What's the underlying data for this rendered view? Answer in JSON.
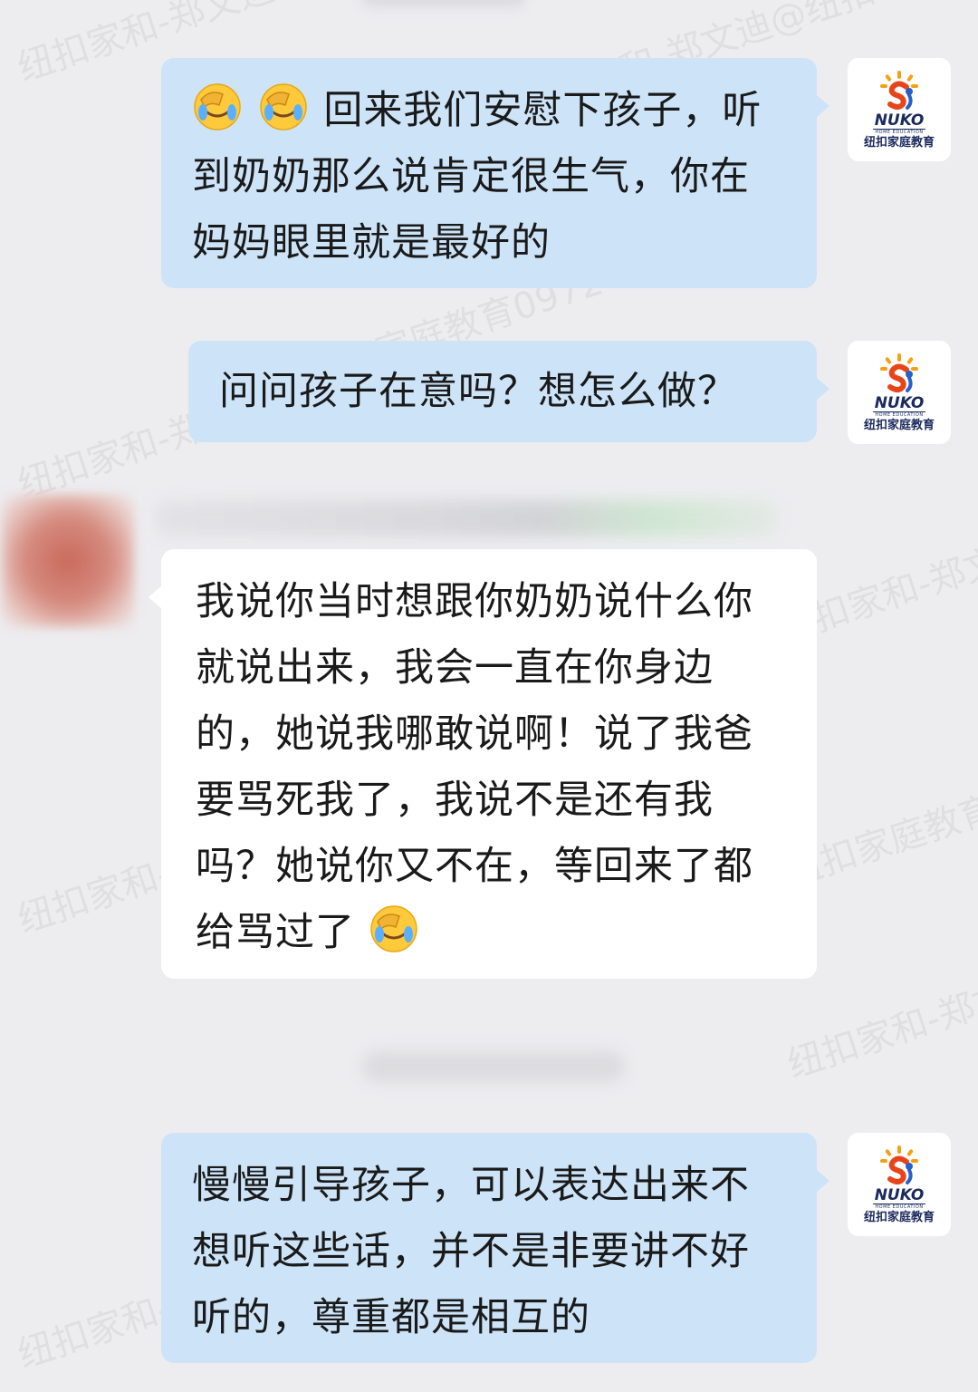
{
  "watermark": {
    "line1": "纽扣家和-郑文迪@纽扣",
    "line2": "纽扣家庭教育0972"
  },
  "logo": {
    "brand": "NUKO",
    "subtitle": "HOME EDUCATION",
    "cn": "纽扣家庭教育"
  },
  "messages": [
    {
      "side": "out",
      "text": "回来我们安慰下孩子，听到奶奶那么说肯定很生气，你在妈妈眼里就是最好的",
      "emoji_prefix": "facepalm-crying-emoji x2"
    },
    {
      "side": "out",
      "text": "问问孩子在意吗？想怎么做？"
    },
    {
      "side": "in",
      "text": "我说你当时想跟你奶奶说什么你就说出来，我会一直在你身边的，她说我哪敢说啊！说了我爸要骂死我了，我说不是还有我吗？她说你又不在，等回来了都给骂过了",
      "emoji_suffix": "facepalm-crying-emoji"
    },
    {
      "side": "out",
      "text": "慢慢引导孩子，可以表达出来不想听这些话，并不是非要讲不好听的，尊重都是相互的"
    }
  ],
  "colors": {
    "background": "#ededf0",
    "outgoing_bubble": "#cde4f8",
    "incoming_bubble": "#ffffff"
  }
}
